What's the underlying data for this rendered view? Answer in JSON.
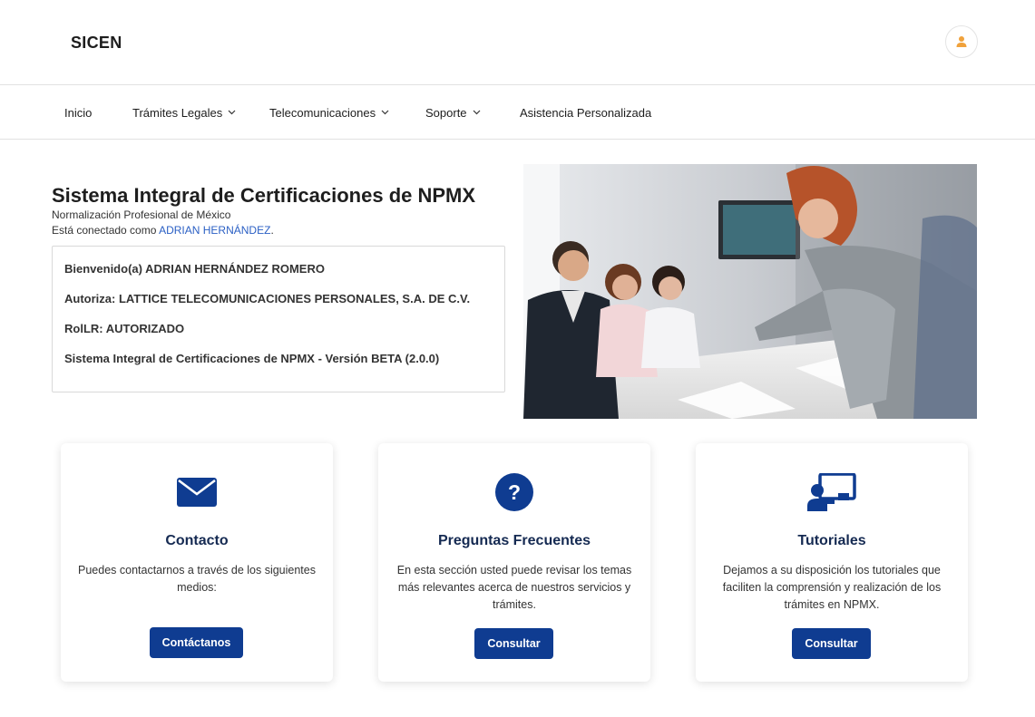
{
  "header": {
    "brand": "SICEN",
    "user_icon": "user-icon"
  },
  "nav": {
    "items": [
      {
        "label": "Inicio",
        "has_dropdown": false
      },
      {
        "label": "Trámites Legales",
        "has_dropdown": true
      },
      {
        "label": "Telecomunicaciones",
        "has_dropdown": true
      },
      {
        "label": "Soporte",
        "has_dropdown": true
      },
      {
        "label": "Asistencia Personalizada",
        "has_dropdown": false
      }
    ]
  },
  "hero": {
    "title": "Sistema Integral de Certificaciones de NPMX",
    "subtitle": "Normalización Profesional  de México",
    "connected_prefix": "Está conectado como ",
    "connected_user": "ADRIAN HERNÁNDEZ",
    "connected_suffix": ".",
    "image_alt": "office-meeting-photo"
  },
  "info": {
    "welcome": "Bienvenido(a) ADRIAN HERNÁNDEZ ROMERO",
    "authorizes": "Autoriza: LATTICE TELECOMUNICACIONES PERSONALES, S.A. DE C.V.",
    "role": "RolLR: AUTORIZADO",
    "version": "Sistema Integral de Certificaciones de NPMX - Versión BETA (2.0.0)"
  },
  "cards": [
    {
      "icon": "envelope-icon",
      "title": "Contacto",
      "text": "Puedes contactarnos a través de los siguientes medios:",
      "button": "Contáctanos"
    },
    {
      "icon": "question-icon",
      "title": "Preguntas Frecuentes",
      "text": "En esta sección usted puede revisar los temas más relevantes acerca de nuestros servicios y trámites.",
      "button": "Consultar"
    },
    {
      "icon": "tutorial-presentation-icon",
      "title": "Tutoriales",
      "text": "Dejamos a su disposición los tutoriales que faciliten la comprensión y realización de los trámites en NPMX.",
      "button": "Consultar"
    }
  ],
  "colors": {
    "primary": "#0f3c91",
    "link": "#2a5fc4",
    "user_icon": "#f0a23c"
  }
}
